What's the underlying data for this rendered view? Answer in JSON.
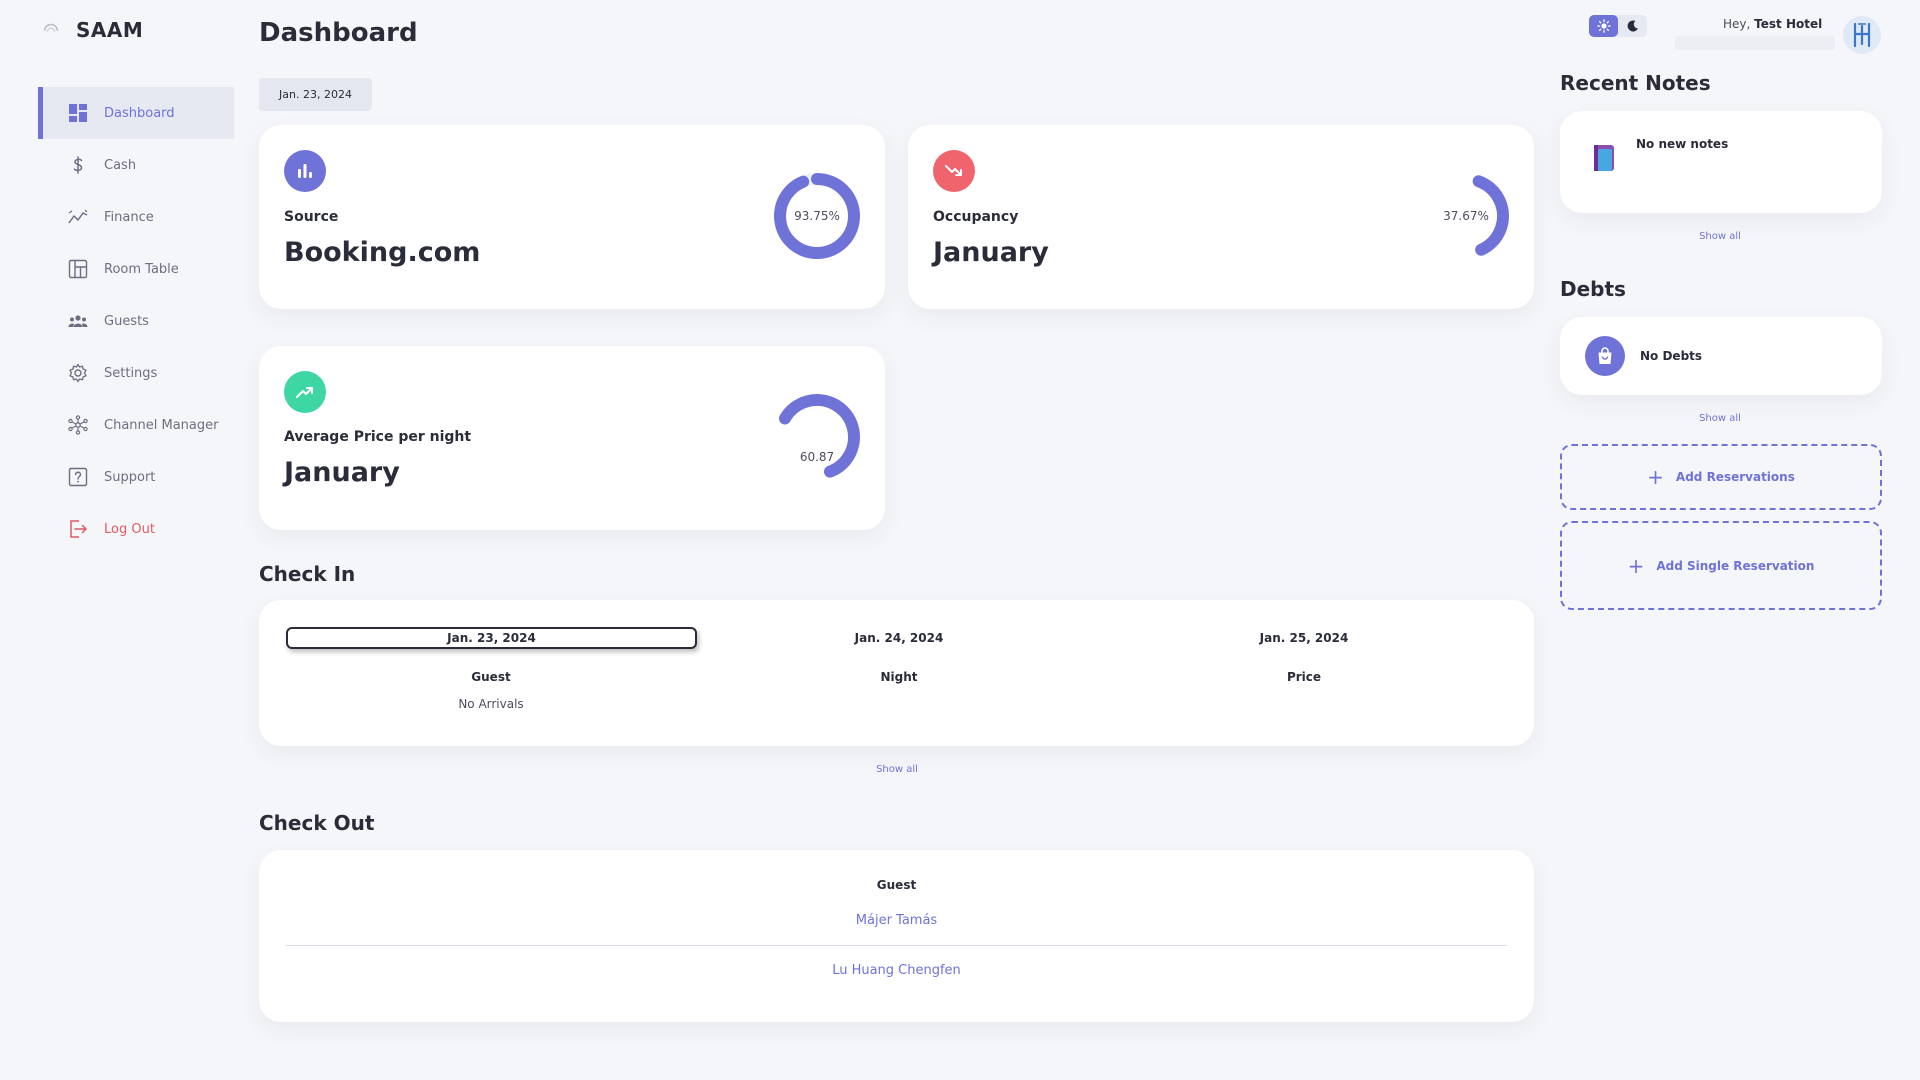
{
  "app": {
    "name": "SAAM"
  },
  "sidebar": {
    "items": [
      {
        "label": "Dashboard",
        "icon": "dashboard-icon",
        "active": true
      },
      {
        "label": "Cash",
        "icon": "dollar-icon"
      },
      {
        "label": "Finance",
        "icon": "trend-icon"
      },
      {
        "label": "Room Table",
        "icon": "room-table-icon"
      },
      {
        "label": "Guests",
        "icon": "guests-icon"
      },
      {
        "label": "Settings",
        "icon": "gear-icon"
      },
      {
        "label": "Channel Manager",
        "icon": "network-icon"
      },
      {
        "label": "Support",
        "icon": "question-icon"
      },
      {
        "label": "Log Out",
        "icon": "logout-icon"
      }
    ]
  },
  "header": {
    "title": "Dashboard",
    "date": "Jan. 23, 2024",
    "greeting_prefix": "Hey,",
    "user_name": "Test Hotel"
  },
  "colors": {
    "accent": "#6f73d8",
    "occupancy_icon": "#f0646e",
    "price_icon": "#3ed6a2",
    "logout": "#e05a63"
  },
  "stats": {
    "source": {
      "label": "Source",
      "value": "Booking.com",
      "percent_text": "93.75%",
      "percent": 93.75
    },
    "occupancy": {
      "label": "Occupancy",
      "value": "January",
      "percent_text": "37.67%",
      "percent": 37.67
    },
    "price": {
      "label": "Average Price per night",
      "value": "January",
      "ring_text": "60.87",
      "percent": 60.87
    }
  },
  "checkin": {
    "title": "Check In",
    "days": [
      "Jan. 23, 2024",
      "Jan. 24, 2024",
      "Jan. 25, 2024"
    ],
    "columns": [
      "Guest",
      "Night",
      "Price"
    ],
    "empty_text": "No Arrivals",
    "show_all": "Show all"
  },
  "checkout": {
    "title": "Check Out",
    "column": "Guest",
    "guests": [
      "Májer Tamás",
      "Lu Huang Chengfen"
    ]
  },
  "notes": {
    "title": "Recent Notes",
    "empty_text": "No new notes",
    "show_all": "Show all"
  },
  "debts": {
    "title": "Debts",
    "empty_text": "No Debts",
    "show_all": "Show all"
  },
  "actions": {
    "add_reservations": "Add Reservations",
    "add_single_reservation": "Add Single Reservation"
  }
}
